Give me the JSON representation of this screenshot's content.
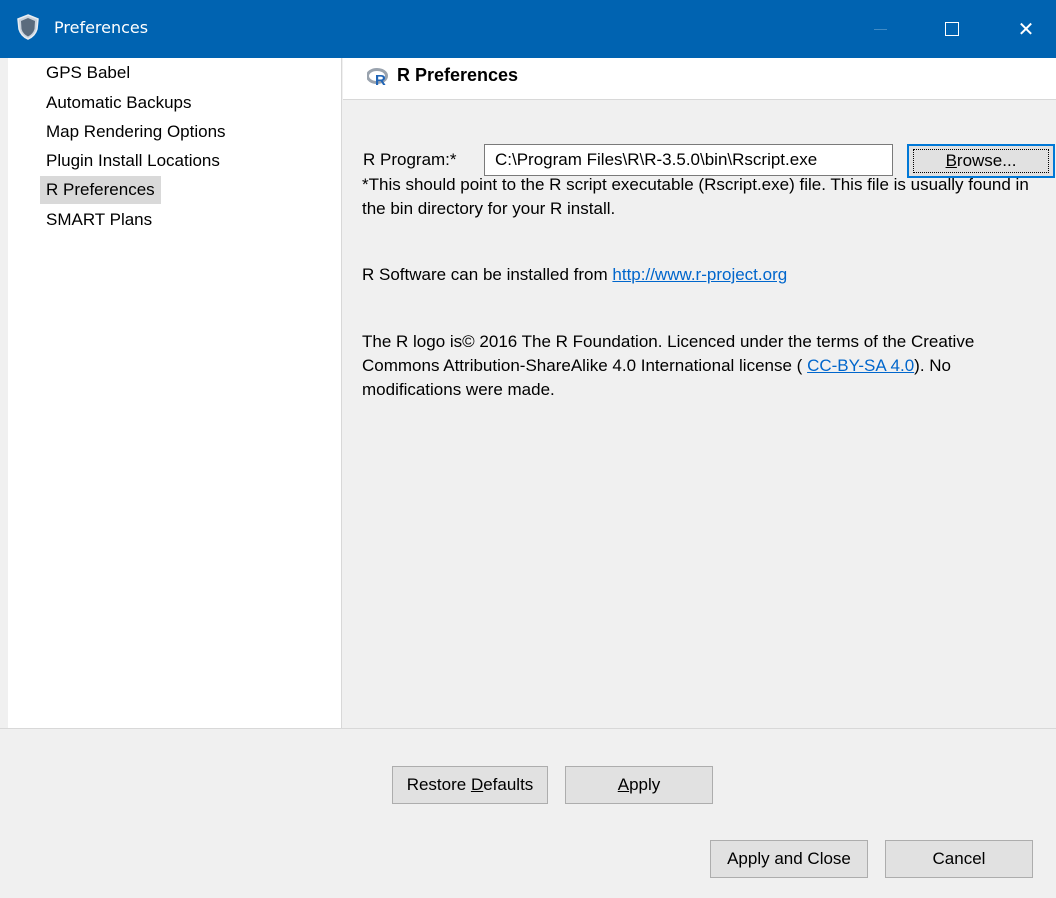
{
  "window": {
    "title": "Preferences",
    "icon": "shield-icon",
    "controls": {
      "minimize": "minimize-icon",
      "maximize": "maximize-icon",
      "close": "close-icon",
      "close_glyph": "✕"
    }
  },
  "sidebar": {
    "items": [
      {
        "label": "GPS Babel",
        "selected": false
      },
      {
        "label": "Automatic Backups",
        "selected": false
      },
      {
        "label": "Map Rendering Options",
        "selected": false
      },
      {
        "label": "Plugin Install Locations",
        "selected": false
      },
      {
        "label": "R Preferences",
        "selected": true
      },
      {
        "label": "SMART Plans",
        "selected": false
      }
    ]
  },
  "main": {
    "header": {
      "icon": "r-logo-icon",
      "title": "R Preferences"
    },
    "r_program": {
      "label": "R Program:*",
      "value": "C:\\Program Files\\R\\R-3.5.0\\bin\\Rscript.exe",
      "browse_label": "Browse..."
    },
    "note": "*This should point to the R script executable (Rscript.exe) file.  This file is usually found in the bin directory for your R install.",
    "install": {
      "text": "R Software can be installed from ",
      "link": "http://www.r-project.org"
    },
    "license": {
      "text_before": "The R logo is© 2016 The R Foundation.  Licenced under the terms of the Creative Commons Attribution-ShareAlike 4.0 International license ( ",
      "link": "CC-BY-SA 4.0",
      "text_after": "). No modifications were made."
    },
    "restore_defaults_prefix": "Restore ",
    "restore_defaults_underlined": "D",
    "restore_defaults_suffix": "efaults",
    "apply_label": "Apply"
  },
  "footer": {
    "apply_close_label": "Apply and Close",
    "cancel_label": "Cancel"
  },
  "colors": {
    "titlebar": "#0063b1",
    "link": "#0066cc",
    "selection": "#d9d9d9",
    "focus": "#0078d7"
  }
}
